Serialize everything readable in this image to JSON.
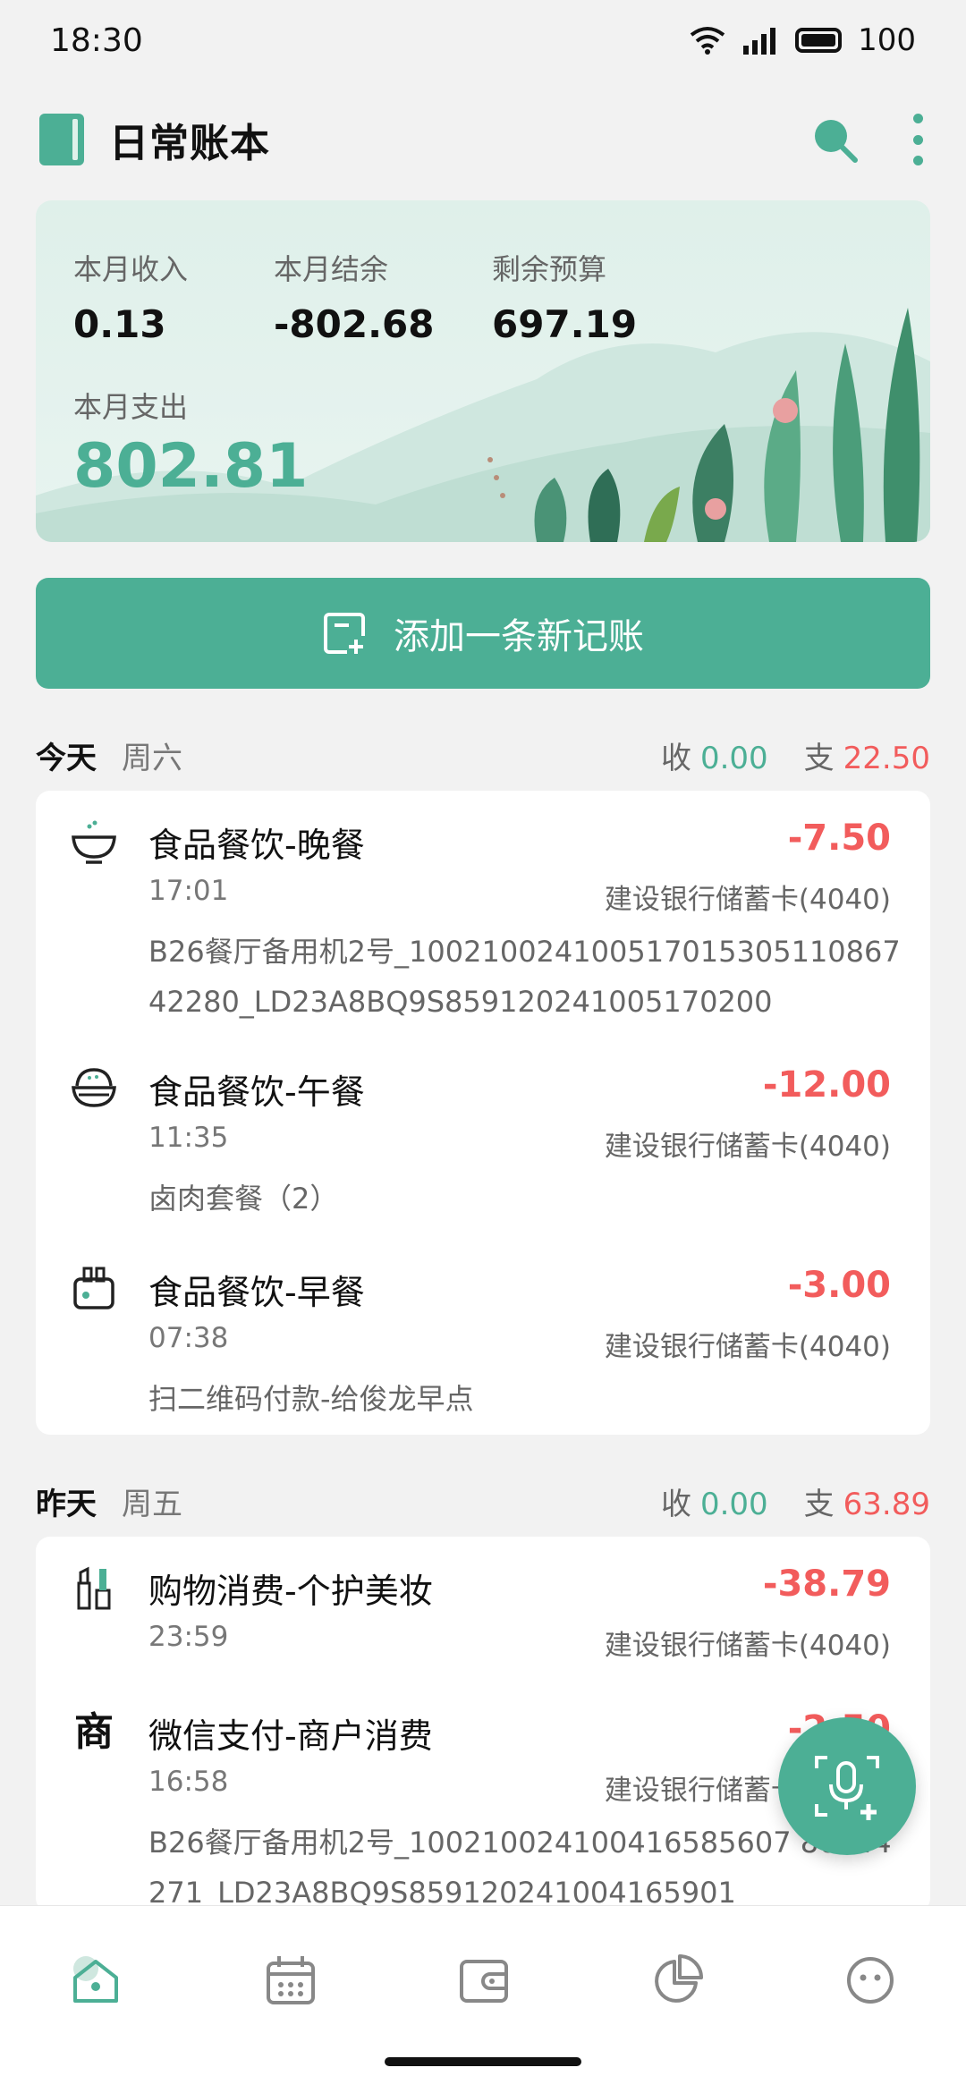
{
  "status_bar": {
    "time": "18:30",
    "battery": "100"
  },
  "header": {
    "title": "日常账本"
  },
  "summary": {
    "income_label": "本月收入",
    "income_value": "0.13",
    "balance_label": "本月结余",
    "balance_value": "-802.68",
    "budget_label": "剩余预算",
    "budget_value": "697.19",
    "expense_label": "本月支出",
    "expense_value": "802.81"
  },
  "add_button": {
    "label": "添加一条新记账"
  },
  "colors": {
    "accent": "#4caf95",
    "expense": "#f25c5c"
  },
  "days": [
    {
      "name": "今天",
      "weekday": "周六",
      "income_label": "收",
      "income": "0.00",
      "expense_label": "支",
      "expense": "22.50",
      "entries": [
        {
          "icon": "bowl-icon",
          "title": "食品餐饮-晚餐",
          "amount": "-7.50",
          "time": "17:01",
          "account": "建设银行储蓄卡(4040)",
          "note": "B26餐厅备用机2号_100210024100517015305110867 42280_LD23A8BQ9S859120241005170200"
        },
        {
          "icon": "rice-bowl-icon",
          "title": "食品餐饮-午餐",
          "amount": "-12.00",
          "time": "11:35",
          "account": "建设银行储蓄卡(4040)",
          "note": "卤肉套餐（2）"
        },
        {
          "icon": "toaster-icon",
          "title": "食品餐饮-早餐",
          "amount": "-3.00",
          "time": "07:38",
          "account": "建设银行储蓄卡(4040)",
          "note": "扫二维码付款-给俊龙早点"
        }
      ]
    },
    {
      "name": "昨天",
      "weekday": "周五",
      "income_label": "收",
      "income": "0.00",
      "expense_label": "支",
      "expense": "63.89",
      "entries": [
        {
          "icon": "cosmetics-icon",
          "title": "购物消费-个护美妆",
          "amount": "-38.79",
          "time": "23:59",
          "account": "建设银行储蓄卡(4040)",
          "note": ""
        },
        {
          "icon_text": "商",
          "title": "微信支付-商户消费",
          "amount": "-2.50",
          "time": "16:58",
          "account": "建设银行储蓄卡(4040)",
          "note": "B26餐厅备用机2号_100210024100416585607 86744271_LD23A8BQ9S859120241004165901"
        }
      ]
    }
  ]
}
